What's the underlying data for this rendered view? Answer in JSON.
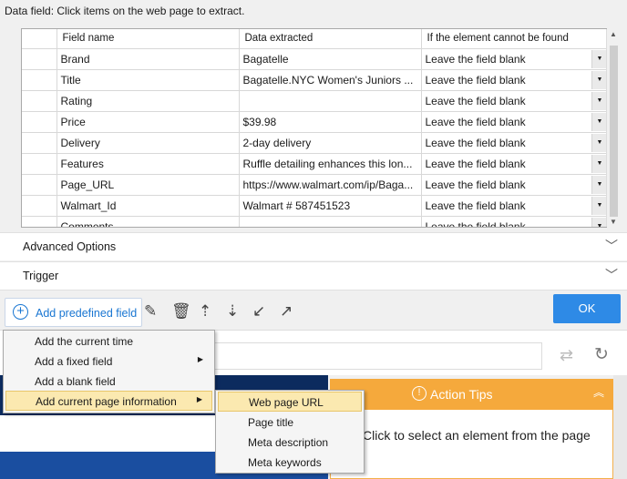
{
  "header": {
    "label": "Data field: Click items on the web page to extract."
  },
  "grid": {
    "columns": [
      "",
      "Field name",
      "Data extracted",
      "If the element cannot be found"
    ],
    "rows": [
      {
        "field": "Brand",
        "data": "Bagatelle",
        "fallback": "Leave the field blank"
      },
      {
        "field": "Title",
        "data": "Bagatelle.NYC Women's Juniors ...",
        "fallback": "Leave the field blank"
      },
      {
        "field": "Rating",
        "data": "",
        "fallback": "Leave the field blank"
      },
      {
        "field": "Price",
        "data": "$39.98",
        "fallback": "Leave the field blank"
      },
      {
        "field": "Delivery",
        "data": "2-day delivery",
        "fallback": "Leave the field blank"
      },
      {
        "field": "Features",
        "data": "Ruffle detailing enhances this lon...",
        "fallback": "Leave the field blank"
      },
      {
        "field": "Page_URL",
        "data": "https://www.walmart.com/ip/Baga...",
        "fallback": "Leave the field blank"
      },
      {
        "field": "Walmart_Id",
        "data": "Walmart #  587451523",
        "fallback": "Leave the field blank"
      },
      {
        "field": "Comments",
        "data": "",
        "fallback": "Leave the field blank"
      }
    ]
  },
  "sections": {
    "advanced": "Advanced Options",
    "trigger": "Trigger"
  },
  "toolbar": {
    "add_field": "Add predefined field",
    "ok": "OK"
  },
  "menu": {
    "items": [
      "Add the current time",
      "Add a fixed field",
      "Add a blank field",
      "Add current page information"
    ],
    "submenu": [
      "Web page URL",
      "Page title",
      "Meta description",
      "Meta keywords"
    ]
  },
  "tips": {
    "title": "Action Tips",
    "text": "Click to select an element from the page"
  },
  "colors": {
    "accent": "#2e8ae6",
    "tips": "#f5a93c",
    "highlight": "#fbe9b0"
  }
}
